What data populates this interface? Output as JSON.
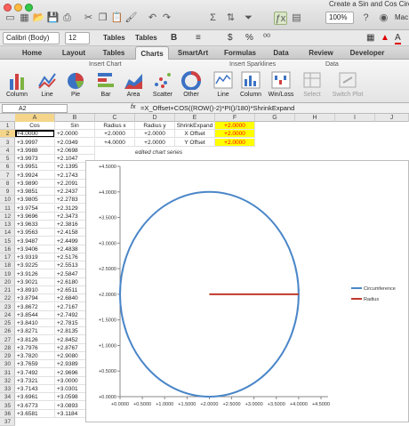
{
  "window": {
    "title": "Create a Sin and Cos Circ",
    "zoom": "100%",
    "user": "Mac"
  },
  "format_bar": {
    "font_name": "Calibri (Body)",
    "font_size": "12",
    "tables_label": "Tables",
    "tables_label2": "Tables"
  },
  "tabs": [
    "Home",
    "Layout",
    "Tables",
    "Charts",
    "SmartArt",
    "Formulas",
    "Data",
    "Review",
    "Developer"
  ],
  "active_tab": "Charts",
  "ribbon": {
    "groups": {
      "insert_chart": "Insert Chart",
      "insert_sparklines": "Insert Sparklines",
      "data": "Data"
    },
    "chart_buttons": [
      "Column",
      "Line",
      "Pie",
      "Bar",
      "Area",
      "Scatter",
      "Other"
    ],
    "sparkline_buttons": [
      "Line",
      "Column",
      "Win/Loss"
    ],
    "data_buttons": [
      "Select",
      "Switch Plot"
    ]
  },
  "formula_bar": {
    "cell_ref": "A2",
    "fx": "fx",
    "formula": "=X_Offset+COS((ROW()-2)*PI()/180)*ShrinkExpand"
  },
  "sheet": {
    "columns": [
      "A",
      "B",
      "C",
      "D",
      "E",
      "F",
      "G",
      "H",
      "I",
      "J"
    ],
    "selected_column": "A",
    "header_row": [
      "Cos",
      "Sin",
      "Radius x",
      "Radius y",
      "ShrinkExpand",
      "+2.0000"
    ],
    "row2_extra": [
      "+2.0000",
      "+2.0000",
      "X Offset",
      "+2.0000"
    ],
    "row3_extra": [
      "+4.0000",
      "+2.0000",
      "Y Offset",
      "+2.0000"
    ],
    "note": "edited chart series",
    "row_numbers": [
      "1",
      "2",
      "3",
      "4",
      "5",
      "6",
      "7",
      "8",
      "9",
      "10",
      "11",
      "12",
      "13",
      "14",
      "15",
      "16",
      "17",
      "18",
      "19",
      "20",
      "21",
      "22",
      "23",
      "24",
      "25",
      "26",
      "27",
      "28",
      "29",
      "30",
      "31",
      "32",
      "33",
      "34",
      "35",
      "36",
      "37"
    ],
    "cos": [
      "+4.0000",
      "+3.9997",
      "+3.9988",
      "+3.9973",
      "+3.9951",
      "+3.9924",
      "+3.9890",
      "+3.9851",
      "+3.9805",
      "+3.9754",
      "+3.9696",
      "+3.9633",
      "+3.9563",
      "+3.9487",
      "+3.9406",
      "+3.9319",
      "+3.9225",
      "+3.9126",
      "+3.9021",
      "+3.8910",
      "+3.8794",
      "+3.8672",
      "+3.8544",
      "+3.8410",
      "+3.8271",
      "+3.8126",
      "+3.7976",
      "+3.7820",
      "+3.7659",
      "+3.7492",
      "+3.7321",
      "+3.7143",
      "+3.6961",
      "+3.6773",
      "+3.6581"
    ],
    "sin": [
      "+2.0000",
      "+2.0349",
      "+2.0698",
      "+2.1047",
      "+2.1395",
      "+2.1743",
      "+2.2091",
      "+2.2437",
      "+2.2783",
      "+2.3129",
      "+2.3473",
      "+2.3816",
      "+2.4158",
      "+2.4499",
      "+2.4838",
      "+2.5176",
      "+2.5513",
      "+2.5847",
      "+2.6180",
      "+2.6511",
      "+2.6840",
      "+2.7167",
      "+2.7492",
      "+2.7815",
      "+2.8135",
      "+2.8452",
      "+2.8767",
      "+2.9080",
      "+2.9389",
      "+2.9696",
      "+3.0000",
      "+3.0301",
      "+3.0598",
      "+3.0893",
      "+3.1184"
    ]
  },
  "chart_data": {
    "type": "scatter",
    "title": "",
    "xlim": [
      0,
      4.5
    ],
    "ylim": [
      0,
      4.5
    ],
    "x_ticks": [
      "+0.0000",
      "+0.5000",
      "+1.0000",
      "+1.5000",
      "+2.0000",
      "+2.5000",
      "+3.0000",
      "+3.5000",
      "+4.0000",
      "+4.5000"
    ],
    "y_ticks": [
      "+0.0000",
      "+0.5000",
      "+1.0000",
      "+1.5000",
      "+2.0000",
      "+2.5000",
      "+3.0000",
      "+3.5000",
      "+4.0000",
      "+4.5000"
    ],
    "series": [
      {
        "name": "Circumference",
        "color": "#4a86c8",
        "shape": "circle",
        "cx": 2,
        "cy": 2,
        "r": 2
      },
      {
        "name": "Radius",
        "color": "#c0392b",
        "x": [
          2,
          4
        ],
        "y": [
          2,
          2
        ]
      }
    ],
    "legend_position": "right",
    "grid": false
  }
}
